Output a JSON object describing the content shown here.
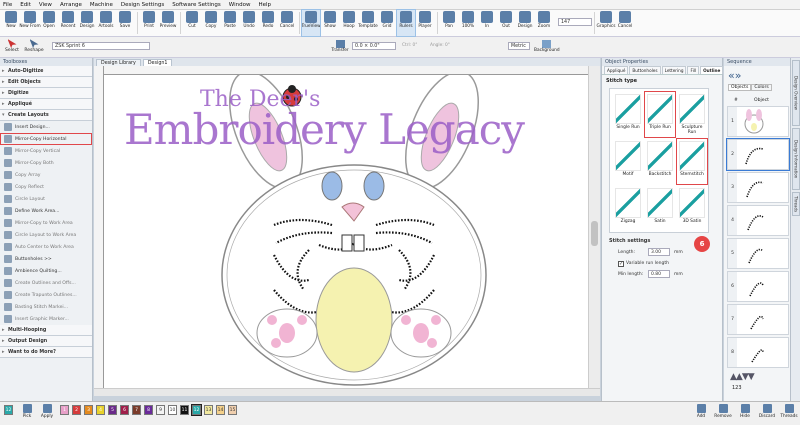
{
  "menu": [
    "File",
    "Edit",
    "View",
    "Arrange",
    "Machine",
    "Design Settings",
    "Software Settings",
    "Window",
    "Help"
  ],
  "ribbon": [
    {
      "label": "New"
    },
    {
      "label": "New From"
    },
    {
      "label": "Open"
    },
    {
      "label": "Recent"
    },
    {
      "label": "Design"
    },
    {
      "label": "Artools"
    },
    {
      "label": "Save"
    },
    {
      "label": "Print"
    },
    {
      "label": "Preview"
    },
    {
      "label": "Cut"
    },
    {
      "label": "Copy"
    },
    {
      "label": "Paste"
    },
    {
      "label": "Undo"
    },
    {
      "label": "Redo"
    },
    {
      "label": "Cancel"
    },
    {
      "label": "TrueView"
    },
    {
      "label": "Show"
    },
    {
      "label": "Hoop"
    },
    {
      "label": "Template"
    },
    {
      "label": "Grid"
    },
    {
      "label": "Rulers"
    },
    {
      "label": "Player"
    },
    {
      "label": "Pan"
    },
    {
      "label": "100%"
    },
    {
      "label": "In"
    },
    {
      "label": "Out"
    },
    {
      "label": "Design"
    },
    {
      "label": "Zoom"
    }
  ],
  "zoom_value": "147",
  "ribbon_right": [
    "Graphics",
    "Cancel"
  ],
  "tool_options": {
    "select": "Select",
    "reshape": "Reshape",
    "machine": "ZSK Sprint 6",
    "transfer": "Transfer",
    "size": "0.0 × 0.0\"",
    "angle1": "Ctrl: 0°",
    "angle2": "Angle: 0°",
    "units": "Metric",
    "background": "Background"
  },
  "toolbox": {
    "title": "Toolboxes",
    "groups_top": [
      "Auto-Digitize",
      "Edit Objects",
      "Digitize",
      "Appliqué",
      "Create Layouts"
    ],
    "items": [
      {
        "label": "Insert Design..."
      },
      {
        "label": "Mirror-Copy Horizontal"
      },
      {
        "label": "Mirror-Copy Vertical"
      },
      {
        "label": "Mirror-Copy Both"
      },
      {
        "label": "Copy Array"
      },
      {
        "label": "Copy Reflect"
      },
      {
        "label": "Circle Layout"
      },
      {
        "label": "Define Work Area..."
      },
      {
        "label": "Mirror-Copy to Work Area"
      },
      {
        "label": "Circle Layout to Work Area"
      },
      {
        "label": "Auto Center to Work Area"
      },
      {
        "label": "Buttonholes >>"
      },
      {
        "label": "Ambience Quilting..."
      },
      {
        "label": "Create Outlines and Offs..."
      },
      {
        "label": "Create Trapunto Outlines..."
      },
      {
        "label": "Basting Stitch Markei..."
      },
      {
        "label": "Insert Graphic Marker..."
      }
    ],
    "groups_bottom": [
      "Multi-Hooping",
      "Output Design",
      "Want to do More?"
    ]
  },
  "doc_tabs": [
    "Design Library",
    "Design1"
  ],
  "canvas": {
    "logo_small": "The Deer's",
    "logo_big": "Embroidery Legacy"
  },
  "object_properties": {
    "title": "Object Properties",
    "tabs": [
      "Appliqué",
      "Buttonholes",
      "Lettering",
      "Fill",
      "Outline"
    ],
    "stitch_type_title": "Stitch type",
    "stitches": [
      {
        "label": "Single Run"
      },
      {
        "label": "Triple Run"
      },
      {
        "label": "Sculpture Run"
      },
      {
        "label": "Motif"
      },
      {
        "label": "Backstitch"
      },
      {
        "label": "Stemstitch"
      },
      {
        "label": "Zigzag"
      },
      {
        "label": "Satin"
      },
      {
        "label": "3D Satin"
      }
    ],
    "settings_title": "Stitch settings",
    "length_label": "Length:",
    "length_value": "3.00",
    "length_unit": "mm",
    "variable_label": "Variable run length",
    "min_label": "Min length:",
    "min_value": "0.80",
    "min_unit": "mm",
    "badge": "6"
  },
  "sequence": {
    "title": "Sequence",
    "tabs": [
      "Objects",
      "Colors"
    ],
    "col_num": "#",
    "col_obj": "Object",
    "rows": [
      "1",
      "2",
      "3",
      "4",
      "5",
      "6",
      "7",
      "8"
    ],
    "footer": "123"
  },
  "side_tabs": [
    "Design Overview",
    "Design Information",
    "Threads"
  ],
  "status": {
    "swatches": [
      {
        "n": "12",
        "c": "#2aa9a9"
      },
      {
        "n": "1",
        "c": "#e8a0c8"
      },
      {
        "n": "2",
        "c": "#d63b3b"
      },
      {
        "n": "3",
        "c": "#e48a1e"
      },
      {
        "n": "4",
        "c": "#e8d12a"
      },
      {
        "n": "5",
        "c": "#6b2a8a"
      },
      {
        "n": "6",
        "c": "#a01f4a"
      },
      {
        "n": "7",
        "c": "#7a3b2a"
      },
      {
        "n": "8",
        "c": "#6a2a9a"
      },
      {
        "n": "9",
        "c": "#f4f4f4"
      },
      {
        "n": "10",
        "c": "#ffffff"
      },
      {
        "n": "11",
        "c": "#111111"
      },
      {
        "n": "12",
        "c": "#2aa9a9"
      },
      {
        "n": "13",
        "c": "#f2e9a0"
      },
      {
        "n": "14",
        "c": "#f4d08a"
      },
      {
        "n": "15",
        "c": "#f0cfae"
      }
    ],
    "pick": "Pick",
    "apply": "Apply",
    "right": [
      "Add",
      "Remove",
      "Hide",
      "Discard",
      "Threads"
    ]
  },
  "colors": {
    "accent": "#1a9fa0",
    "highlight": "#e0474a",
    "logo_purple": "#9b5fc7"
  }
}
